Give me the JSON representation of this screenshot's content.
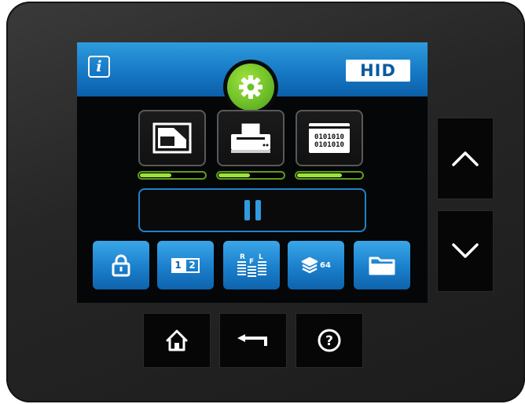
{
  "topbar": {
    "info_icon": "info-icon",
    "info_glyph": "i",
    "brand": "HID",
    "settings_icon": "gear-icon"
  },
  "status": {
    "tiles": [
      {
        "name": "card-status",
        "icon": "card-icon",
        "level": 0.5
      },
      {
        "name": "printer-status",
        "icon": "printer-icon",
        "level": 0.5
      },
      {
        "name": "encoder-status",
        "icon": "encoder-icon",
        "encoder_digits": [
          "0101010",
          "0101010"
        ],
        "level": 0.7
      }
    ],
    "level_color": "#9be23a"
  },
  "pause": {
    "icon": "pause-icon",
    "accent": "#2f9be0"
  },
  "tools": {
    "items": [
      {
        "name": "lock",
        "icon": "lock-icon"
      },
      {
        "name": "duplex",
        "icon": "duplex-icon",
        "labels": [
          "1",
          "2"
        ]
      },
      {
        "name": "ribbon-panels",
        "icon": "ribbon-panels-icon",
        "letters": [
          "R",
          "F",
          "L"
        ]
      },
      {
        "name": "copies",
        "icon": "layers-icon",
        "count": "64"
      },
      {
        "name": "folder",
        "icon": "folder-icon"
      }
    ]
  },
  "side": {
    "up_icon": "chevron-up-icon",
    "down_icon": "chevron-down-icon"
  },
  "bottom": {
    "home_icon": "home-icon",
    "back_icon": "back-arrow-icon",
    "help_icon": "help-icon",
    "help_glyph": "?"
  },
  "colors": {
    "accent_blue": "#1679c6",
    "accent_green": "#6fc12a",
    "bezel": "#262626"
  }
}
